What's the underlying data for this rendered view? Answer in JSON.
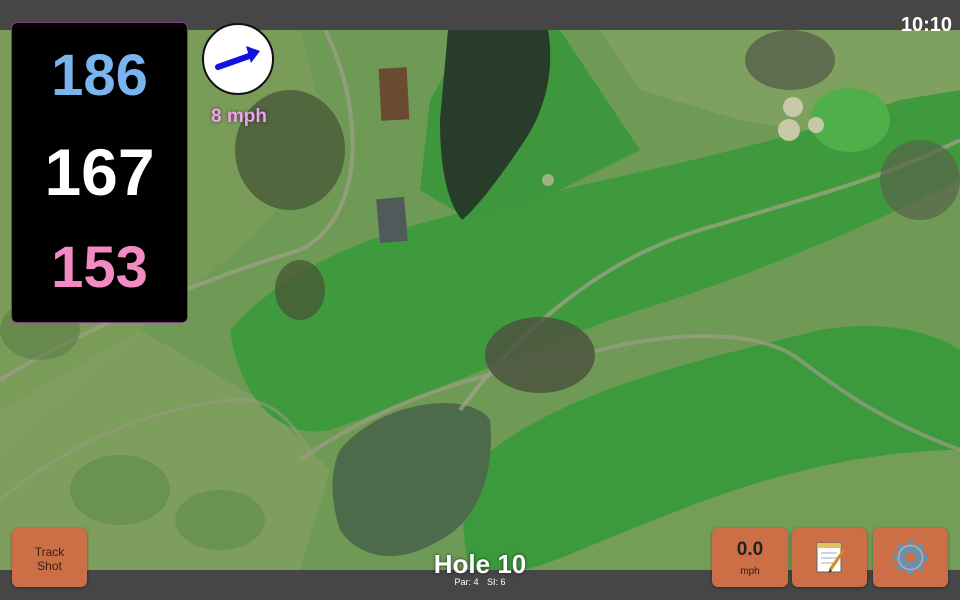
{
  "clock": "10:10",
  "distances": {
    "back": "186",
    "middle": "167",
    "front": "153"
  },
  "wind": {
    "speed": "8 mph",
    "icon": "wind-direction-arrow-icon"
  },
  "buttons": {
    "track_shot": "Track Shot",
    "speed_value": "0.0",
    "speed_unit": "mph",
    "notes_icon": "notepad-icon",
    "settings_icon": "gear-icon"
  },
  "hole": {
    "title": "Hole 10",
    "par": "Par: 4",
    "si": "SI: 6"
  },
  "colors": {
    "back": "#7ab4ef",
    "middle": "#ffffff",
    "front": "#f48ac2",
    "button": "#cc6f47",
    "wind_text": "#f0a0f0"
  }
}
